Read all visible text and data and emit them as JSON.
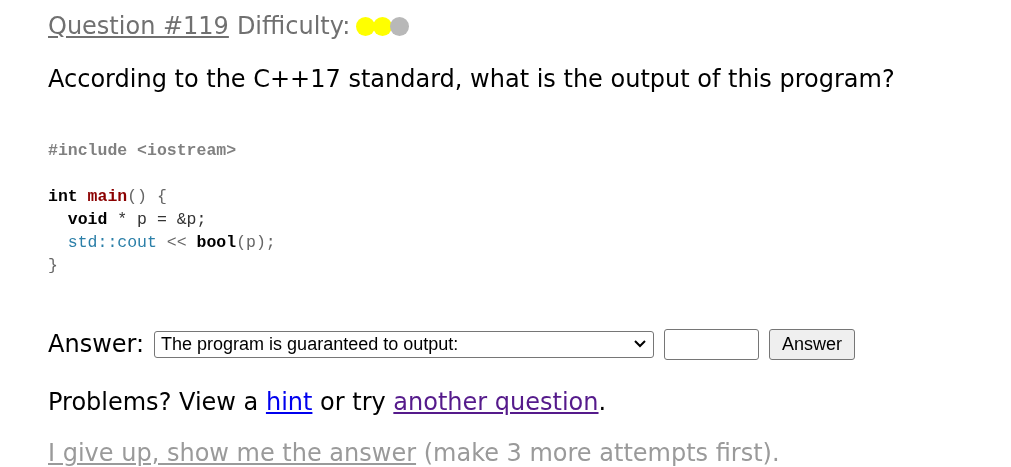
{
  "header": {
    "question_link": "Question #119",
    "difficulty_label": "Difficulty:",
    "difficulty_dots": [
      {
        "filled": true
      },
      {
        "filled": true
      },
      {
        "filled": false
      }
    ]
  },
  "question": "According to the C++17 standard, what is the output of this program?",
  "code": [
    {
      "kind": "code",
      "tokens": [
        {
          "kind": "preproc",
          "text": "#include <iostream>"
        }
      ]
    },
    {
      "kind": "blank"
    },
    {
      "kind": "code",
      "tokens": [
        {
          "kind": "keyword",
          "text": "int "
        },
        {
          "kind": "function",
          "text": "main"
        },
        {
          "kind": "punct",
          "text": "() {"
        }
      ]
    },
    {
      "kind": "code",
      "indent": true,
      "tokens": [
        {
          "kind": "keyword",
          "text": "void"
        },
        {
          "kind": "plain",
          "text": " * p = &p;"
        }
      ]
    },
    {
      "kind": "code",
      "indent": true,
      "tokens": [
        {
          "kind": "library",
          "text": "std::cout"
        },
        {
          "kind": "punct",
          "text": " << "
        },
        {
          "kind": "keyword",
          "text": "bool"
        },
        {
          "kind": "punct",
          "text": "(p);"
        }
      ]
    },
    {
      "kind": "code",
      "tokens": [
        {
          "kind": "punct",
          "text": "}"
        }
      ]
    }
  ],
  "answer": {
    "label": "Answer:",
    "select_value": "The program is guaranteed to output:",
    "button": "Answer"
  },
  "problems": [
    {
      "kind": "text",
      "text": "Problems? View a "
    },
    {
      "kind": "link",
      "text": "hint",
      "visited": false
    },
    {
      "kind": "text",
      "text": " or try "
    },
    {
      "kind": "link",
      "text": "another question",
      "visited": true
    },
    {
      "kind": "text",
      "text": "."
    }
  ],
  "give_up": {
    "link": "I give up, show me the answer",
    "disabled": true,
    "note": " (make 3 more attempts first)."
  }
}
